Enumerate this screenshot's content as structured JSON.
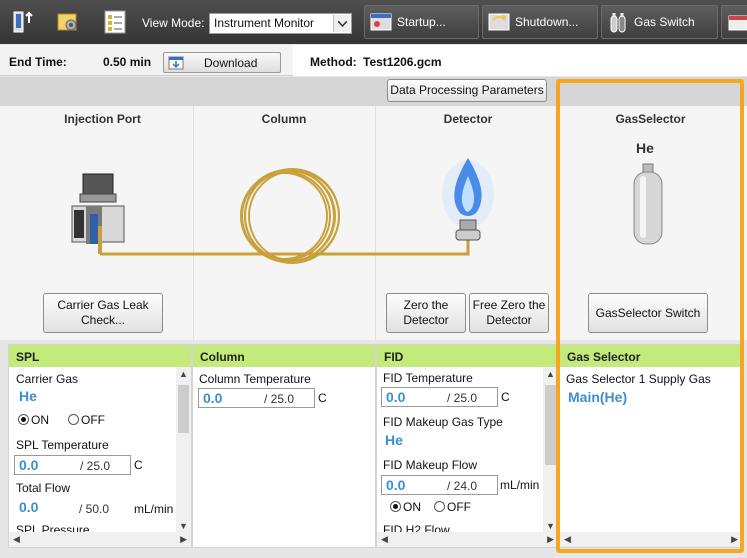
{
  "toolbar": {
    "view_mode_label": "View Mode:",
    "view_mode_value": "Instrument Monitor",
    "startup_label": "Startup...",
    "shutdown_label": "Shutdown...",
    "gas_switch_label": "Gas Switch"
  },
  "infobar": {
    "end_time_label": "End Time:",
    "end_time_value": "0.50 min",
    "download_label": "Download",
    "method_label": "Method:",
    "method_value": "Test1206.gcm"
  },
  "dpp_button": "Data Processing Parameters",
  "diagram": {
    "injection_port": "Injection Port",
    "column": "Column",
    "detector": "Detector",
    "gas_selector": "GasSelector",
    "gas_name": "He",
    "carrier_leak_check": "Carrier Gas Leak Check...",
    "zero_detector": "Zero the Detector",
    "free_zero_detector": "Free Zero the Detector",
    "gas_selector_switch": "GasSelector Switch"
  },
  "spl": {
    "title": "SPL",
    "carrier_gas_label": "Carrier Gas",
    "carrier_gas_value": "He",
    "on_label": "ON",
    "off_label": "OFF",
    "temp_label": "SPL Temperature",
    "temp_value": "0.0",
    "temp_set": "/ 25.0",
    "temp_unit": "C",
    "flow_label": "Total Flow",
    "flow_value": "0.0",
    "flow_set": "/ 50.0",
    "flow_unit": "mL/min",
    "pressure_label": "SPL Pressure"
  },
  "column": {
    "title": "Column",
    "temp_label": "Column Temperature",
    "temp_value": "0.0",
    "temp_set": "/ 25.0",
    "temp_unit": "C"
  },
  "fid": {
    "title": "FID",
    "temp_label": "FID Temperature",
    "temp_value": "0.0",
    "temp_set": "/ 25.0",
    "temp_unit": "C",
    "makeup_type_label": "FID Makeup Gas Type",
    "makeup_type_value": "He",
    "makeup_flow_label": "FID Makeup Flow",
    "makeup_flow_value": "0.0",
    "makeup_flow_set": "/ 24.0",
    "makeup_flow_unit": "mL/min",
    "on_label": "ON",
    "off_label": "OFF",
    "h2_flow_label": "FID H2 Flow"
  },
  "gas_selector_panel": {
    "title": "Gas Selector",
    "supply_label": "Gas Selector 1 Supply Gas",
    "supply_value": "Main(He)"
  },
  "colors": {
    "panel_header": "#c3ea7b",
    "value_blue": "#3a8fd0",
    "highlight": "#f5a623"
  }
}
